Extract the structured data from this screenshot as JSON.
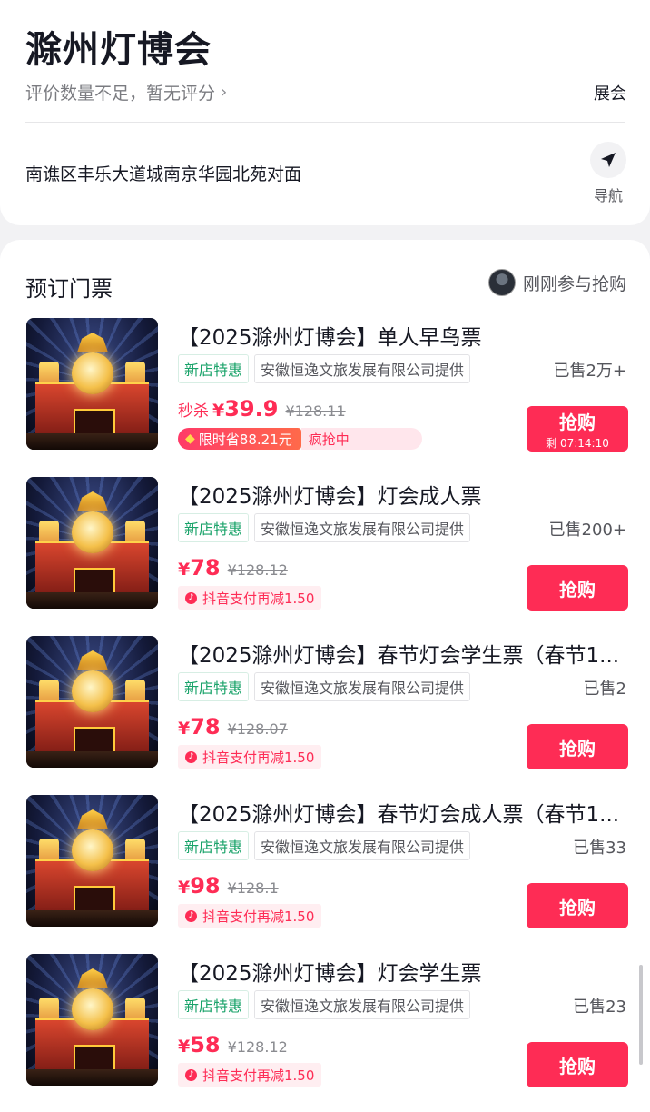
{
  "venue": {
    "title": "滁州灯博会",
    "rating_text": "评价数量不足，暂无评分",
    "category": "展会",
    "address": "南谯区丰乐大道城南京华园北苑对面",
    "nav_label": "导航"
  },
  "tickets_section": {
    "title": "预订门票",
    "recent_text": "刚刚参与抢购"
  },
  "colors": {
    "accent": "#fe2c55",
    "tag_green": "#1aa36a"
  },
  "tickets": [
    {
      "name": "【2025滁州灯博会】单人早鸟票",
      "tag_new": "新店特惠",
      "provider": "安徽恒逸文旅发展有限公司提供",
      "sold": "已售2万+",
      "flash_label": "秒杀",
      "price_symbol": "¥",
      "price": "39.9",
      "original_price": "¥128.11",
      "save_text": "限时省88.21元",
      "hot_text": "疯抢中",
      "buy_label": "抢购",
      "countdown": "剩 07:14:10"
    },
    {
      "name": "【2025滁州灯博会】灯会成人票",
      "tag_new": "新店特惠",
      "provider": "安徽恒逸文旅发展有限公司提供",
      "sold": "已售200+",
      "price_symbol": "¥",
      "price": "78",
      "original_price": "¥128.12",
      "pay_text": "抖音支付再减1.50",
      "buy_label": "抢购"
    },
    {
      "name": "【2025滁州灯博会】春节灯会学生票（春节1...",
      "tag_new": "新店特惠",
      "provider": "安徽恒逸文旅发展有限公司提供",
      "sold": "已售2",
      "price_symbol": "¥",
      "price": "78",
      "original_price": "¥128.07",
      "pay_text": "抖音支付再减1.50",
      "buy_label": "抢购"
    },
    {
      "name": "【2025滁州灯博会】春节灯会成人票（春节1...",
      "tag_new": "新店特惠",
      "provider": "安徽恒逸文旅发展有限公司提供",
      "sold": "已售33",
      "price_symbol": "¥",
      "price": "98",
      "original_price": "¥128.1",
      "pay_text": "抖音支付再减1.50",
      "buy_label": "抢购"
    },
    {
      "name": "【2025滁州灯博会】灯会学生票",
      "tag_new": "新店特惠",
      "provider": "安徽恒逸文旅发展有限公司提供",
      "sold": "已售23",
      "price_symbol": "¥",
      "price": "58",
      "original_price": "¥128.12",
      "pay_text": "抖音支付再减1.50",
      "buy_label": "抢购"
    }
  ]
}
